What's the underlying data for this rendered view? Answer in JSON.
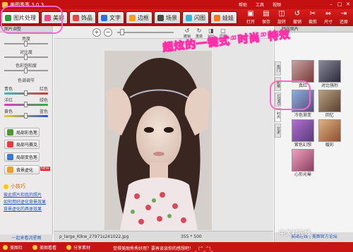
{
  "titlebar": {
    "title": "美图秀秀 3.0.3",
    "menus": [
      "帮助",
      "工具",
      "视频"
    ],
    "controls": [
      "–",
      "□",
      "✕"
    ]
  },
  "tabs": [
    {
      "label": "图片处理",
      "color": "#2a9d3a"
    },
    {
      "label": "美容",
      "color": "#e84a8a"
    },
    {
      "label": "饰品",
      "color": "#e64545"
    },
    {
      "label": "文字",
      "color": "#2f6fd6"
    },
    {
      "label": "边框",
      "color": "#f0a020"
    },
    {
      "label": "场景",
      "color": "#4a4a4a"
    },
    {
      "label": "闪图",
      "color": "#3bb0e0"
    },
    {
      "label": "娃娃",
      "color": "#f07a20"
    }
  ],
  "toolbar": [
    {
      "glyph": "▣",
      "label": "打开"
    },
    {
      "glyph": "▤",
      "label": "保存"
    },
    {
      "glyph": "◫",
      "label": "旋转"
    },
    {
      "glyph": "↺",
      "label": "撤销"
    },
    {
      "glyph": "✂",
      "label": "裁剪"
    },
    {
      "glyph": "⇔",
      "label": "尺寸"
    },
    {
      "glyph": "⇥",
      "label": "还原"
    }
  ],
  "left_panel": {
    "header": "图片调整",
    "sliders": {
      "brightness": "亮度",
      "contrast": "对比度",
      "saturation": "色彩饱和度",
      "color_tuning": "色调调节"
    },
    "color_pairs": [
      {
        "left": "青色",
        "right": "红色"
      },
      {
        "left": "洋红",
        "right": "绿色"
      },
      {
        "left": "黄色",
        "right": "蓝色"
      }
    ],
    "buttons": [
      {
        "label": "局部彩色笔",
        "color": "#4a9a2e"
      },
      {
        "label": "局部马赛克",
        "color": "#e04040"
      },
      {
        "label": "局部变色笔",
        "color": "#3a7ad0"
      },
      {
        "label": "背景虚化",
        "color": "#f0a020"
      }
    ],
    "new_badge": "NEW",
    "tips_title": "小技巧",
    "tips": [
      "彼此照片和我的照片",
      "如何用好虚化背景效果",
      "背景虚化的具体效果"
    ],
    "bottom_link": "一起来看流星雨"
  },
  "center": {
    "zoom_in": "+",
    "zoom_out": "−",
    "canvas_tools": [
      {
        "glyph": "↺",
        "label": "撤销"
      },
      {
        "glyph": "↻",
        "label": "重做"
      },
      {
        "glyph": "◨",
        "label": "对比"
      },
      {
        "glyph": "▢",
        "label": "原图"
      }
    ],
    "filename": "p_large_KIkw_27971s241022.jpg",
    "dimensions": "355 * 500"
  },
  "right_panel": {
    "header": "特效图片",
    "vtabs": [
      "热门",
      "影楼",
      "LOMO",
      "时尚",
      "艺术"
    ],
    "effects": [
      {
        "label": "真红",
        "color1": "#c8a2a2",
        "color2": "#7a3a3a"
      },
      {
        "label": "对比强烈",
        "color1": "#8a8a9a",
        "color2": "#2a2a3a"
      },
      {
        "label": "冷色渐变",
        "color1": "#8ab0e0",
        "color2": "#5a4a7a"
      },
      {
        "label": "回忆",
        "color1": "#b8a080",
        "color2": "#5a4030"
      },
      {
        "label": "紫色幻想",
        "color1": "#b070d0",
        "color2": "#5a3a7a"
      },
      {
        "label": "暖彩",
        "color1": "#e0b080",
        "color2": "#8a5030"
      },
      {
        "label": "心形光晕",
        "color1": "#f0a0c0",
        "color2": "#8a4060"
      }
    ],
    "footer": "美图在线 | 美图官方论坛"
  },
  "bottombar": {
    "items": [
      "美图社",
      "美图看看",
      "分享素材"
    ],
    "marquee": "觉得美图秀秀好用？要再谈谈你的感想吧！ _ (^_^)_"
  },
  "overlay": {
    "text": "超炫的一键式“时尚”特效",
    "watermark": "中关村在线"
  }
}
